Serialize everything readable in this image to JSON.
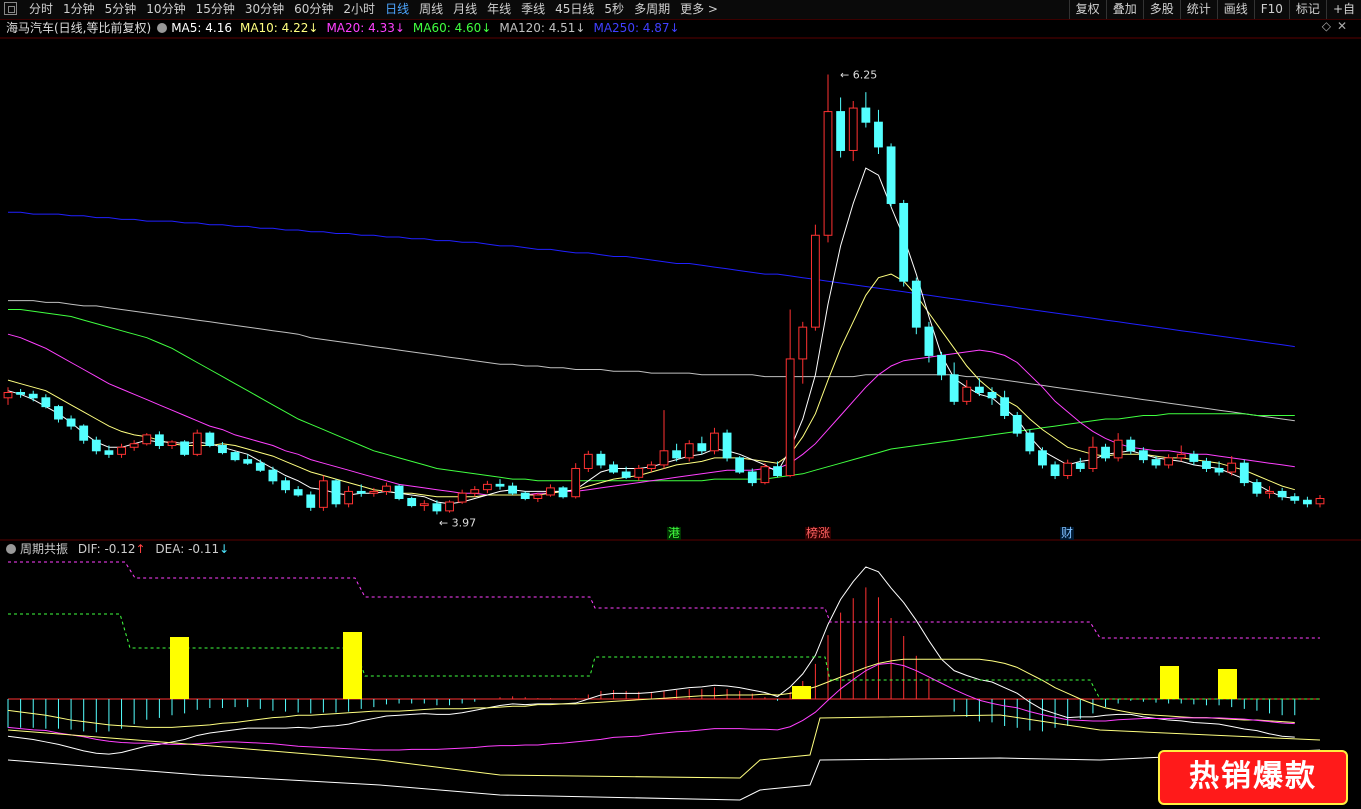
{
  "toolbar": {
    "periods": [
      "分时",
      "1分钟",
      "5分钟",
      "10分钟",
      "15分钟",
      "30分钟",
      "60分钟",
      "2小时",
      "日线",
      "周线",
      "月线",
      "年线",
      "季线",
      "45日线",
      "5秒",
      "多周期",
      "更多 >"
    ],
    "active_period": "日线",
    "right_tools": [
      "复权",
      "叠加",
      "多股",
      "统计",
      "画线",
      "F10",
      "标记",
      "+自"
    ]
  },
  "title": {
    "stock": "海马汽车(日线,等比前复权)",
    "ma": [
      {
        "label": "MA5: 4.16",
        "arrow": "",
        "color": "#ffffff"
      },
      {
        "label": "MA10: 4.22",
        "arrow": "↓",
        "color": "#ffff80"
      },
      {
        "label": "MA20: 4.33",
        "arrow": "↓",
        "color": "#ff40ff"
      },
      {
        "label": "MA60: 4.60",
        "arrow": "↓",
        "color": "#40ff40"
      },
      {
        "label": "MA120: 4.51",
        "arrow": "↓",
        "color": "#c0c0c0"
      },
      {
        "label": "MA250: 4.87",
        "arrow": "↓",
        "color": "#4040ff"
      }
    ]
  },
  "indicator": {
    "name": "周期共振",
    "dif": "DIF: -0.12",
    "dif_arrow": "↑",
    "dea": "DEA: -0.11",
    "dea_arrow": "↓"
  },
  "markers": [
    {
      "text": "港",
      "color": "#40ff40",
      "bg": "#003300"
    },
    {
      "text": "榜涨",
      "color": "#ff6060",
      "bg": "#330000"
    },
    {
      "text": "财",
      "color": "#80c0ff",
      "bg": "#001a33"
    }
  ],
  "badge": "热销爆款",
  "colors": {
    "up": "#ff3232",
    "down": "#54ffff",
    "ma5": "#ffffff",
    "ma10": "#ffff80",
    "ma20": "#ff40ff",
    "ma60": "#40ff40",
    "ma120": "#c0c0c0",
    "ma250": "#2020ff"
  },
  "chart_data": {
    "type": "candlestick",
    "price_range": [
      3.7,
      6.4
    ],
    "high_label": "6.25",
    "low_label": "3.97",
    "candles": [
      [
        4.42,
        4.48,
        4.38,
        4.45
      ],
      [
        4.45,
        4.47,
        4.42,
        4.44
      ],
      [
        4.44,
        4.46,
        4.4,
        4.42
      ],
      [
        4.42,
        4.44,
        4.36,
        4.37
      ],
      [
        4.37,
        4.38,
        4.28,
        4.3
      ],
      [
        4.3,
        4.32,
        4.24,
        4.26
      ],
      [
        4.26,
        4.27,
        4.16,
        4.18
      ],
      [
        4.18,
        4.2,
        4.1,
        4.12
      ],
      [
        4.12,
        4.15,
        4.08,
        4.1
      ],
      [
        4.1,
        4.16,
        4.08,
        4.14
      ],
      [
        4.14,
        4.18,
        4.12,
        4.16
      ],
      [
        4.16,
        4.22,
        4.15,
        4.21
      ],
      [
        4.21,
        4.23,
        4.13,
        4.15
      ],
      [
        4.15,
        4.18,
        4.13,
        4.17
      ],
      [
        4.17,
        4.18,
        4.09,
        4.1
      ],
      [
        4.1,
        4.24,
        4.09,
        4.22
      ],
      [
        4.22,
        4.23,
        4.14,
        4.15
      ],
      [
        4.15,
        4.17,
        4.1,
        4.11
      ],
      [
        4.11,
        4.12,
        4.06,
        4.07
      ],
      [
        4.07,
        4.1,
        4.04,
        4.05
      ],
      [
        4.05,
        4.07,
        4.0,
        4.01
      ],
      [
        4.01,
        4.03,
        3.93,
        3.95
      ],
      [
        3.95,
        3.97,
        3.88,
        3.9
      ],
      [
        3.9,
        3.92,
        3.86,
        3.87
      ],
      [
        3.87,
        3.89,
        3.78,
        3.8
      ],
      [
        3.8,
        3.98,
        3.78,
        3.95
      ],
      [
        3.95,
        3.96,
        3.8,
        3.82
      ],
      [
        3.82,
        3.92,
        3.8,
        3.89
      ],
      [
        3.89,
        3.93,
        3.86,
        3.88
      ],
      [
        3.88,
        3.91,
        3.86,
        3.89
      ],
      [
        3.89,
        3.94,
        3.87,
        3.92
      ],
      [
        3.92,
        3.93,
        3.84,
        3.85
      ],
      [
        3.85,
        3.86,
        3.8,
        3.81
      ],
      [
        3.81,
        3.84,
        3.78,
        3.82
      ],
      [
        3.82,
        3.84,
        3.76,
        3.78
      ],
      [
        3.78,
        3.84,
        3.77,
        3.83
      ],
      [
        3.83,
        3.9,
        3.82,
        3.88
      ],
      [
        3.88,
        3.92,
        3.86,
        3.9
      ],
      [
        3.9,
        3.95,
        3.88,
        3.93
      ],
      [
        3.93,
        3.96,
        3.9,
        3.92
      ],
      [
        3.92,
        3.94,
        3.87,
        3.88
      ],
      [
        3.88,
        3.89,
        3.84,
        3.85
      ],
      [
        3.85,
        3.88,
        3.83,
        3.87
      ],
      [
        3.87,
        3.93,
        3.86,
        3.91
      ],
      [
        3.91,
        3.92,
        3.85,
        3.86
      ],
      [
        3.86,
        4.05,
        3.85,
        4.02
      ],
      [
        4.02,
        4.12,
        4.0,
        4.1
      ],
      [
        4.1,
        4.12,
        4.02,
        4.04
      ],
      [
        4.04,
        4.06,
        3.99,
        4.0
      ],
      [
        4.0,
        4.03,
        3.96,
        3.97
      ],
      [
        3.97,
        4.04,
        3.95,
        4.02
      ],
      [
        4.02,
        4.06,
        4.0,
        4.04
      ],
      [
        4.04,
        4.35,
        4.02,
        4.12
      ],
      [
        4.12,
        4.16,
        4.06,
        4.08
      ],
      [
        4.08,
        4.18,
        4.06,
        4.16
      ],
      [
        4.16,
        4.2,
        4.1,
        4.12
      ],
      [
        4.12,
        4.25,
        4.1,
        4.22
      ],
      [
        4.22,
        4.24,
        4.06,
        4.08
      ],
      [
        4.08,
        4.09,
        3.99,
        4.0
      ],
      [
        4.0,
        4.02,
        3.92,
        3.94
      ],
      [
        3.94,
        4.05,
        3.93,
        4.03
      ],
      [
        4.03,
        4.06,
        3.97,
        3.98
      ],
      [
        3.98,
        4.92,
        3.97,
        4.64
      ],
      [
        4.64,
        4.85,
        4.5,
        4.82
      ],
      [
        4.82,
        5.4,
        4.8,
        5.34
      ],
      [
        5.34,
        6.25,
        5.3,
        6.04
      ],
      [
        6.04,
        6.12,
        5.78,
        5.82
      ],
      [
        5.82,
        6.1,
        5.76,
        6.06
      ],
      [
        6.06,
        6.15,
        5.95,
        5.98
      ],
      [
        5.98,
        6.05,
        5.8,
        5.84
      ],
      [
        5.84,
        5.86,
        5.5,
        5.52
      ],
      [
        5.52,
        5.54,
        5.05,
        5.08
      ],
      [
        5.08,
        5.1,
        4.78,
        4.82
      ],
      [
        4.82,
        4.85,
        4.62,
        4.66
      ],
      [
        4.66,
        4.68,
        4.52,
        4.55
      ],
      [
        4.55,
        4.62,
        4.38,
        4.4
      ],
      [
        4.4,
        4.52,
        4.38,
        4.48
      ],
      [
        4.48,
        4.53,
        4.43,
        4.45
      ],
      [
        4.45,
        4.48,
        4.38,
        4.42
      ],
      [
        4.42,
        4.46,
        4.3,
        4.32
      ],
      [
        4.32,
        4.34,
        4.2,
        4.22
      ],
      [
        4.22,
        4.24,
        4.1,
        4.12
      ],
      [
        4.12,
        4.14,
        4.02,
        4.04
      ],
      [
        4.04,
        4.06,
        3.96,
        3.98
      ],
      [
        3.98,
        4.07,
        3.96,
        4.05
      ],
      [
        4.05,
        4.08,
        4.0,
        4.02
      ],
      [
        4.02,
        4.2,
        4.0,
        4.14
      ],
      [
        4.14,
        4.16,
        4.06,
        4.08
      ],
      [
        4.08,
        4.22,
        4.06,
        4.18
      ],
      [
        4.18,
        4.2,
        4.1,
        4.12
      ],
      [
        4.12,
        4.14,
        4.05,
        4.07
      ],
      [
        4.07,
        4.09,
        4.02,
        4.04
      ],
      [
        4.04,
        4.1,
        4.02,
        4.08
      ],
      [
        4.08,
        4.15,
        4.06,
        4.1
      ],
      [
        4.1,
        4.12,
        4.04,
        4.06
      ],
      [
        4.06,
        4.08,
        4.0,
        4.02
      ],
      [
        4.02,
        4.06,
        3.98,
        4.0
      ],
      [
        4.0,
        4.09,
        3.98,
        4.05
      ],
      [
        4.05,
        4.07,
        3.92,
        3.94
      ],
      [
        3.94,
        3.96,
        3.86,
        3.88
      ],
      [
        3.88,
        3.92,
        3.85,
        3.89
      ],
      [
        3.89,
        3.91,
        3.84,
        3.86
      ],
      [
        3.86,
        3.88,
        3.82,
        3.84
      ],
      [
        3.84,
        3.86,
        3.8,
        3.82
      ],
      [
        3.82,
        3.87,
        3.8,
        3.85
      ]
    ],
    "ma5": [
      4.46,
      4.44,
      4.41,
      4.37,
      4.33,
      4.28,
      4.22,
      4.17,
      4.14,
      4.14,
      4.16,
      4.18,
      4.17,
      4.17,
      4.16,
      4.17,
      4.16,
      4.14,
      4.12,
      4.1,
      4.06,
      4.02,
      3.98,
      3.95,
      3.91,
      3.9,
      3.88,
      3.87,
      3.88,
      3.88,
      3.89,
      3.88,
      3.87,
      3.86,
      3.83,
      3.82,
      3.83,
      3.85,
      3.87,
      3.89,
      3.9,
      3.89,
      3.89,
      3.89,
      3.89,
      3.9,
      3.95,
      4.0,
      4.02,
      4.02,
      4.02,
      4.03,
      4.05,
      4.07,
      4.09,
      4.1,
      4.13,
      4.12,
      4.1,
      4.07,
      4.04,
      4.0,
      4.13,
      4.3,
      4.55,
      4.95,
      5.28,
      5.52,
      5.72,
      5.68,
      5.5,
      5.33,
      5.12,
      4.88,
      4.66,
      4.53,
      4.48,
      4.44,
      4.42,
      4.36,
      4.3,
      4.2,
      4.12,
      4.08,
      4.04,
      4.06,
      4.07,
      4.1,
      4.11,
      4.12,
      4.1,
      4.08,
      4.07,
      4.06,
      4.04,
      4.03,
      4.02,
      3.99,
      3.96,
      3.93,
      3.89,
      3.86,
      3.85
    ],
    "ma10": [
      4.52,
      4.5,
      4.48,
      4.46,
      4.42,
      4.38,
      4.34,
      4.3,
      4.26,
      4.23,
      4.21,
      4.2,
      4.18,
      4.16,
      4.15,
      4.15,
      4.15,
      4.16,
      4.15,
      4.13,
      4.11,
      4.09,
      4.06,
      4.03,
      4.0,
      3.98,
      3.96,
      3.94,
      3.92,
      3.9,
      3.89,
      3.88,
      3.88,
      3.87,
      3.86,
      3.86,
      3.86,
      3.86,
      3.87,
      3.87,
      3.87,
      3.87,
      3.87,
      3.88,
      3.89,
      3.9,
      3.92,
      3.94,
      3.96,
      3.97,
      3.98,
      4.0,
      4.02,
      4.04,
      4.05,
      4.06,
      4.08,
      4.08,
      4.08,
      4.07,
      4.06,
      4.05,
      4.1,
      4.2,
      4.33,
      4.52,
      4.7,
      4.85,
      5.0,
      5.1,
      5.12,
      5.08,
      5.0,
      4.9,
      4.8,
      4.7,
      4.6,
      4.52,
      4.46,
      4.41,
      4.37,
      4.3,
      4.24,
      4.19,
      4.14,
      4.12,
      4.1,
      4.09,
      4.1,
      4.1,
      4.1,
      4.09,
      4.08,
      4.08,
      4.07,
      4.06,
      4.05,
      4.03,
      4.01,
      3.98,
      3.95,
      3.92,
      3.9
    ],
    "ma20": [
      4.78,
      4.76,
      4.73,
      4.7,
      4.66,
      4.62,
      4.58,
      4.54,
      4.5,
      4.47,
      4.44,
      4.41,
      4.38,
      4.35,
      4.32,
      4.29,
      4.26,
      4.24,
      4.21,
      4.19,
      4.17,
      4.15,
      4.12,
      4.1,
      4.07,
      4.05,
      4.03,
      4.01,
      3.99,
      3.97,
      3.95,
      3.93,
      3.92,
      3.91,
      3.9,
      3.89,
      3.88,
      3.88,
      3.87,
      3.87,
      3.87,
      3.87,
      3.88,
      3.88,
      3.89,
      3.89,
      3.9,
      3.91,
      3.92,
      3.93,
      3.94,
      3.95,
      3.96,
      3.97,
      3.98,
      3.99,
      4.0,
      4.01,
      4.01,
      4.01,
      4.02,
      4.02,
      4.05,
      4.1,
      4.16,
      4.24,
      4.32,
      4.4,
      4.48,
      4.55,
      4.6,
      4.63,
      4.64,
      4.65,
      4.66,
      4.67,
      4.68,
      4.69,
      4.68,
      4.66,
      4.62,
      4.55,
      4.48,
      4.4,
      4.34,
      4.28,
      4.23,
      4.19,
      4.16,
      4.14,
      4.13,
      4.12,
      4.12,
      4.11,
      4.1,
      4.1,
      4.09,
      4.08,
      4.07,
      4.06,
      4.05,
      4.04,
      4.03
    ],
    "ma60": [
      4.92,
      4.92,
      4.91,
      4.9,
      4.89,
      4.88,
      4.86,
      4.84,
      4.82,
      4.8,
      4.78,
      4.76,
      4.73,
      4.7,
      4.66,
      4.62,
      4.58,
      4.54,
      4.5,
      4.46,
      4.42,
      4.38,
      4.34,
      4.3,
      4.27,
      4.24,
      4.21,
      4.18,
      4.15,
      4.12,
      4.1,
      4.08,
      4.06,
      4.04,
      4.02,
      4.01,
      4.0,
      3.99,
      3.98,
      3.97,
      3.96,
      3.96,
      3.95,
      3.95,
      3.95,
      3.95,
      3.95,
      3.95,
      3.95,
      3.95,
      3.95,
      3.95,
      3.95,
      3.95,
      3.95,
      3.95,
      3.96,
      3.96,
      3.96,
      3.96,
      3.96,
      3.97,
      3.98,
      3.99,
      4.01,
      4.03,
      4.05,
      4.07,
      4.09,
      4.11,
      4.13,
      4.14,
      4.15,
      4.16,
      4.17,
      4.18,
      4.19,
      4.2,
      4.21,
      4.22,
      4.23,
      4.24,
      4.25,
      4.26,
      4.27,
      4.28,
      4.29,
      4.3,
      4.3,
      4.31,
      4.32,
      4.32,
      4.33,
      4.33,
      4.33,
      4.33,
      4.33,
      4.33,
      4.33,
      4.32,
      4.32,
      4.32,
      4.32
    ],
    "ma120": [
      4.97,
      4.97,
      4.97,
      4.96,
      4.96,
      4.95,
      4.94,
      4.94,
      4.93,
      4.92,
      4.91,
      4.9,
      4.89,
      4.88,
      4.87,
      4.86,
      4.85,
      4.84,
      4.83,
      4.82,
      4.81,
      4.8,
      4.79,
      4.78,
      4.76,
      4.75,
      4.74,
      4.73,
      4.72,
      4.71,
      4.7,
      4.69,
      4.68,
      4.67,
      4.66,
      4.65,
      4.64,
      4.63,
      4.62,
      4.61,
      4.61,
      4.6,
      4.6,
      4.59,
      4.59,
      4.58,
      4.58,
      4.58,
      4.57,
      4.57,
      4.57,
      4.56,
      4.56,
      4.56,
      4.56,
      4.55,
      4.55,
      4.55,
      4.55,
      4.55,
      4.54,
      4.54,
      4.54,
      4.54,
      4.54,
      4.54,
      4.54,
      4.54,
      4.55,
      4.55,
      4.55,
      4.55,
      4.55,
      4.55,
      4.55,
      4.55,
      4.54,
      4.54,
      4.53,
      4.52,
      4.51,
      4.5,
      4.49,
      4.48,
      4.47,
      4.46,
      4.45,
      4.44,
      4.43,
      4.42,
      4.41,
      4.4,
      4.39,
      4.38,
      4.37,
      4.36,
      4.35,
      4.34,
      4.33,
      4.32,
      4.31,
      4.3,
      4.29
    ],
    "ma250": [
      5.47,
      5.47,
      5.46,
      5.46,
      5.46,
      5.45,
      5.45,
      5.44,
      5.44,
      5.43,
      5.43,
      5.42,
      5.42,
      5.42,
      5.41,
      5.41,
      5.4,
      5.4,
      5.39,
      5.39,
      5.38,
      5.38,
      5.37,
      5.37,
      5.36,
      5.36,
      5.35,
      5.35,
      5.34,
      5.34,
      5.33,
      5.33,
      5.32,
      5.32,
      5.31,
      5.31,
      5.3,
      5.3,
      5.29,
      5.28,
      5.28,
      5.27,
      5.26,
      5.26,
      5.25,
      5.24,
      5.24,
      5.23,
      5.22,
      5.22,
      5.21,
      5.2,
      5.19,
      5.18,
      5.18,
      5.17,
      5.16,
      5.15,
      5.14,
      5.13,
      5.12,
      5.12,
      5.11,
      5.1,
      5.09,
      5.08,
      5.07,
      5.06,
      5.05,
      5.04,
      5.03,
      5.02,
      5.01,
      5.0,
      4.99,
      4.98,
      4.97,
      4.96,
      4.95,
      4.94,
      4.93,
      4.92,
      4.91,
      4.9,
      4.89,
      4.88,
      4.87,
      4.86,
      4.85,
      4.84,
      4.83,
      4.82,
      4.81,
      4.8,
      4.79,
      4.78,
      4.77,
      4.76,
      4.75,
      4.74,
      4.73,
      4.72,
      4.71
    ]
  }
}
